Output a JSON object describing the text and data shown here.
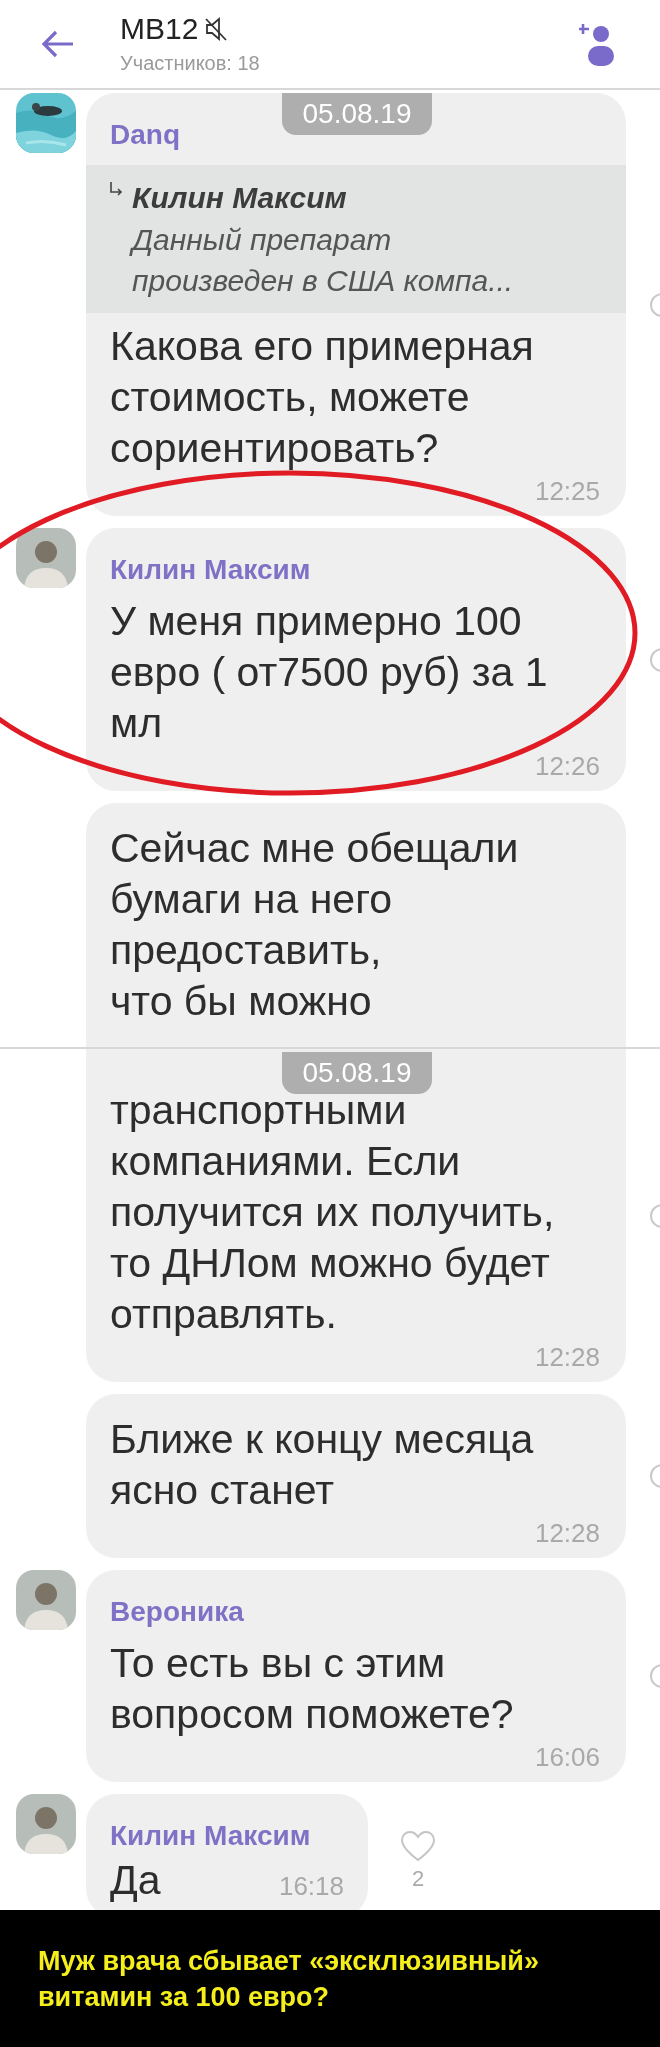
{
  "header": {
    "title": "MB12",
    "muted": true,
    "subtitle": "Участников: 18"
  },
  "screens": [
    {
      "date": "05.08.19",
      "messages": [
        {
          "kind": "full",
          "sender": "Danq",
          "quote": {
            "sender": "Килин Максим",
            "text": "Данный препарат произведен в США компа..."
          },
          "text": "Какова его примерная стоимость, можете сориентировать?",
          "time": "12:25"
        },
        {
          "kind": "full",
          "avatar": {
            "kind": "person"
          },
          "sender": "Килин Максим",
          "circled": true,
          "text": "У меня примерно 100 евро ( от7500 руб) за 1 мл",
          "time": "12:26"
        },
        {
          "kind": "cut_bottom",
          "text": "Сейчас мне обещали бумаги на него предоставить,\nчто бы можно"
        }
      ]
    },
    {
      "date": "05.08.19",
      "messages": [
        {
          "kind": "cut_top",
          "text": "транспортными компаниями. Если получится их получить, то ДНЛом можно будет отправлять.",
          "time": "12:28"
        },
        {
          "kind": "full",
          "text": "Ближе к концу месяца ясно станет",
          "time": "12:28"
        },
        {
          "kind": "full",
          "avatar": {
            "kind": "person"
          },
          "sender": "Вероника",
          "text": "То есть вы с этим вопросом поможете?",
          "time": "16:06"
        },
        {
          "kind": "short",
          "avatar": {
            "kind": "person"
          },
          "sender": "Килин Максим",
          "text": "Да",
          "time": "16:18",
          "likes": "2"
        }
      ]
    }
  ],
  "caption": {
    "lines": [
      "Муж врача сбывает «эксклюзивный»",
      "витамин за 100 евро?"
    ]
  }
}
